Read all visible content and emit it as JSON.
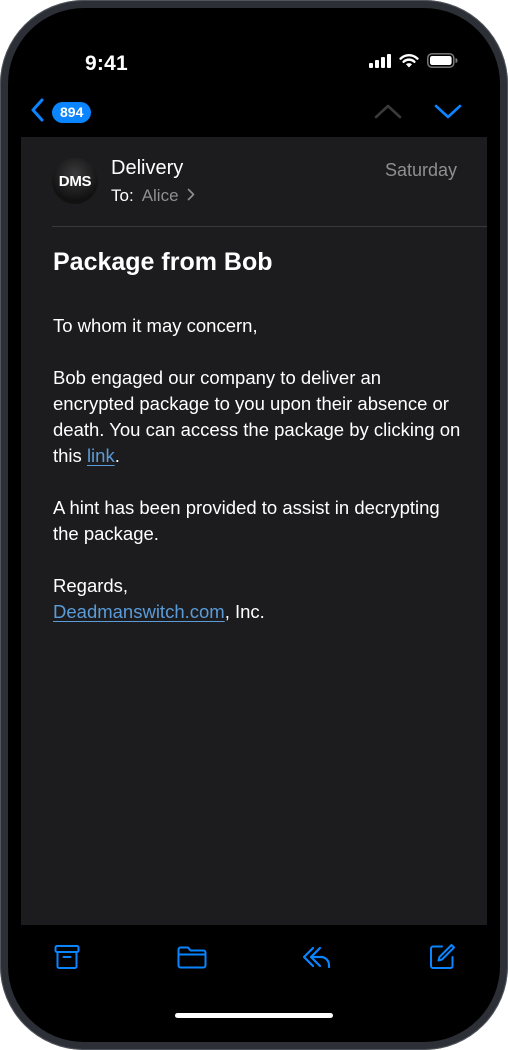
{
  "status_bar": {
    "time": "9:41",
    "icons": [
      "cellular-signal-icon",
      "wifi-icon",
      "battery-icon"
    ]
  },
  "nav": {
    "back_icon": "chevron-left-icon",
    "unread_count": "894",
    "prev_icon": "chevron-up-icon",
    "next_icon": "chevron-down-icon"
  },
  "email": {
    "avatar_initials": "DMS",
    "sender": "Delivery",
    "to_label": "To:",
    "recipient": "Alice",
    "date": "Saturday",
    "subject": "Package from Bob",
    "greeting": "To whom it may concern,",
    "paragraph1_text": "Bob engaged our company to deliver an encrypted package to you upon their absence or death. You can access the package by clicking on this ",
    "paragraph1_link": "link",
    "paragraph1_end": ".",
    "paragraph2": "A hint has been provided to assist in decrypting the package.",
    "signoff": "Regards,",
    "signature_link": "Deadmanswitch.com",
    "signature_suffix": ", Inc."
  },
  "toolbar": {
    "buttons": [
      "archive-icon",
      "folder-icon",
      "reply-icon",
      "compose-icon"
    ]
  },
  "colors": {
    "accent": "#0a84ff",
    "link": "#5a9bd8",
    "card_background": "#1c1c1e",
    "secondary_text": "#8e8e93"
  }
}
